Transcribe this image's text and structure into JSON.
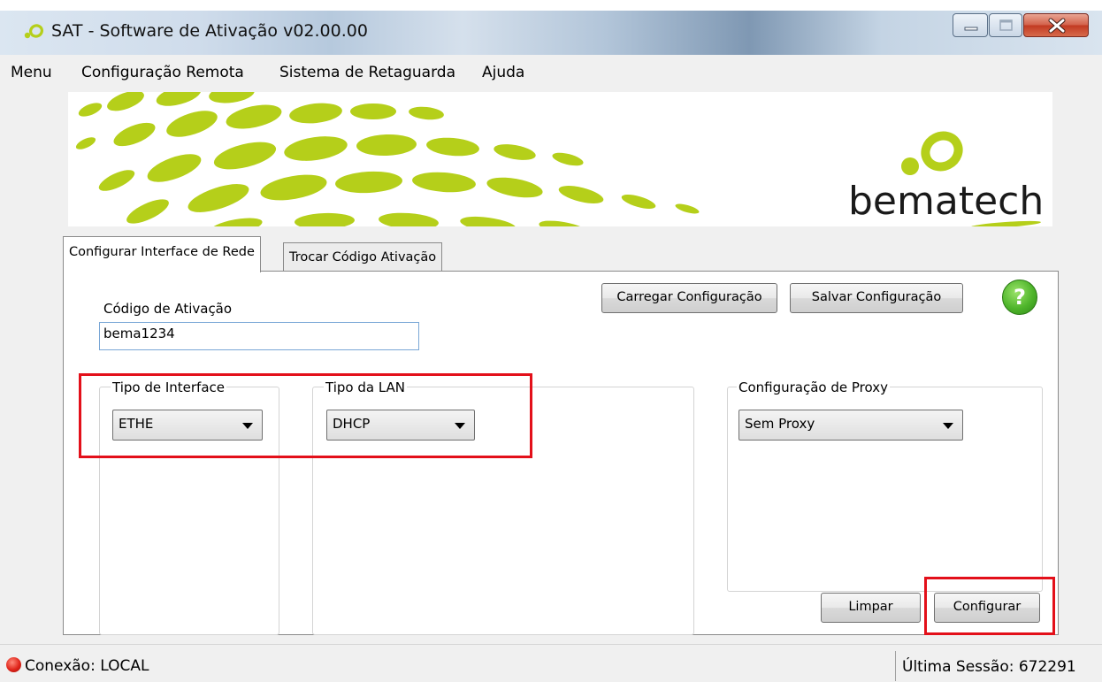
{
  "window": {
    "title": "SAT - Software de Ativação v02.00.00",
    "minimize_icon": "minimize-icon",
    "maximize_icon": "maximize-icon",
    "close_icon": "close-icon"
  },
  "menu": {
    "items": [
      "Menu",
      "Configuração Remota",
      "Sistema de Retaguarda",
      "Ajuda"
    ]
  },
  "banner": {
    "brand": "bematech",
    "brand_color": "#b5cf1a"
  },
  "tabs": [
    {
      "label": "Configurar Interface de Rede",
      "active": true
    },
    {
      "label": "Trocar Código Ativação",
      "active": false
    }
  ],
  "form": {
    "codigo_label": "Código de Ativação",
    "codigo_value": "bema1234",
    "load_button": "Carregar Configuração",
    "save_button": "Salvar Configuração",
    "help_icon": "?",
    "interface_group": "Tipo de Interface",
    "interface_value": "ETHE",
    "lan_group": "Tipo da LAN",
    "lan_value": "DHCP",
    "proxy_group": "Configuração de Proxy",
    "proxy_value": "Sem Proxy",
    "clear_button": "Limpar",
    "configure_button": "Configurar"
  },
  "highlight_color": "#e3101a",
  "status": {
    "connection": "Conexão: LOCAL",
    "connection_color": "#e0251a",
    "last_session": "Última Sessão: 672291"
  }
}
